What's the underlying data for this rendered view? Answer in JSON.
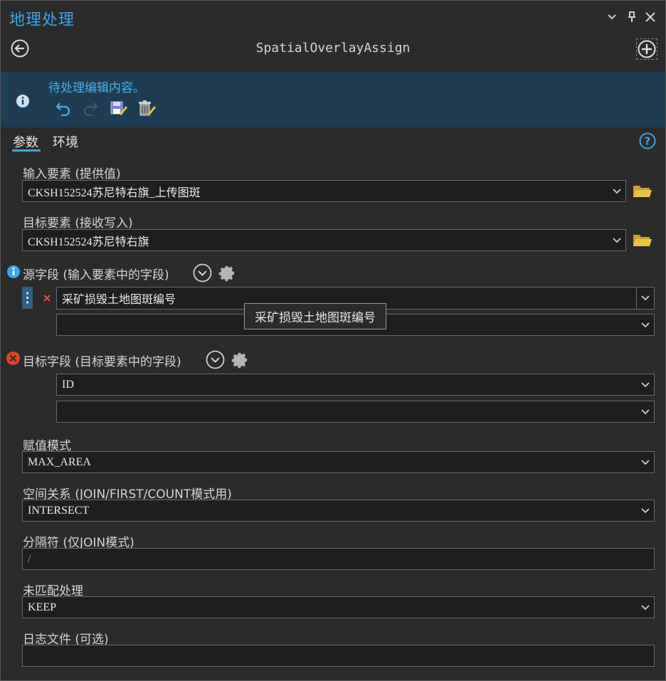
{
  "window": {
    "title": "地理处理",
    "buttons": {
      "menu_icon": "chevron-down-icon",
      "pin_icon": "pin-icon",
      "close_icon": "close-icon"
    }
  },
  "tool": {
    "name": "SpatialOverlayAssign"
  },
  "banner": {
    "message": "待处理编辑内容。",
    "tools": [
      "undo-icon",
      "redo-icon",
      "save-edits-icon",
      "discard-edits-icon"
    ]
  },
  "tabs": [
    {
      "label": "参数",
      "selected": true
    },
    {
      "label": "环境",
      "selected": false
    }
  ],
  "params": {
    "input_features": {
      "label": "输入要素 (提供值)",
      "value": "CKSH152524苏尼特右旗_上传图斑"
    },
    "target_features": {
      "label": "目标要素 (接收写入)",
      "value": "CKSH152524苏尼特右旗"
    },
    "source_fields": {
      "label": "源字段 (输入要素中的字段)",
      "value": "采矿损毁土地图斑编号",
      "value2": "",
      "tooltip": "采矿损毁土地图斑编号"
    },
    "target_fields": {
      "label": "目标字段 (目标要素中的字段)",
      "value": "ID",
      "value2": ""
    },
    "assign_mode": {
      "label": "赋值模式",
      "value": "MAX_AREA"
    },
    "spatial_relation": {
      "label": "空间关系 (JOIN/FIRST/COUNT模式用)",
      "value": "INTERSECT"
    },
    "separator": {
      "label": "分隔符 (仅JOIN模式)",
      "value": "/"
    },
    "unmatched": {
      "label": "未匹配处理",
      "value": "KEEP"
    },
    "log_file": {
      "label": "日志文件 (可选)",
      "value": ""
    }
  },
  "colors": {
    "accent": "#3fa3e8",
    "banner_bg": "#1e3d52",
    "error": "#d9472b",
    "folder": "#e8c34a"
  }
}
